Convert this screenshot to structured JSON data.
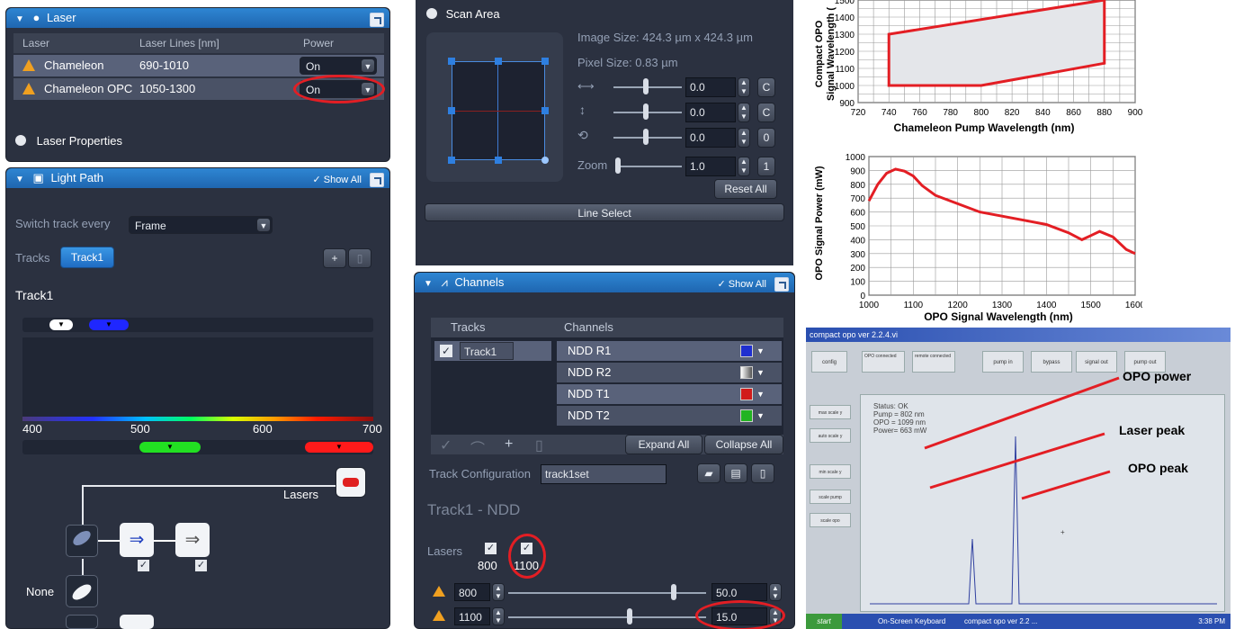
{
  "laser_panel": {
    "title": "Laser",
    "columns": [
      "Laser",
      "Laser Lines [nm]",
      "Power"
    ],
    "rows": [
      {
        "name": "Chameleon",
        "lines": "690-1010",
        "power": "On"
      },
      {
        "name": "Chameleon OPC",
        "lines": "1050-1300",
        "power": "On"
      }
    ],
    "properties_label": "Laser Properties"
  },
  "lightpath_panel": {
    "title": "Light Path",
    "show_all": "Show All",
    "switch_label": "Switch track every",
    "switch_value": "Frame",
    "tracks_label": "Tracks",
    "track_button": "Track1",
    "track_title": "Track1",
    "spectrum_ticks": [
      "400",
      "500",
      "600",
      "700"
    ],
    "lasers_label": "Lasers",
    "none_label": "None"
  },
  "scan_panel": {
    "title": "Scan Area",
    "image_size": "Image Size:  424.3 µm x 424.3 µm",
    "pixel_size": "Pixel Size:   0.83 µm",
    "offset_x": "0.0",
    "offset_y": "0.0",
    "rotation": "0.0",
    "zoom_label": "Zoom",
    "zoom_value": "1.0",
    "btn_c1": "C",
    "btn_c2": "C",
    "btn_0": "0",
    "btn_1": "1",
    "reset_all": "Reset All",
    "line_select": "Line Select"
  },
  "channels_panel": {
    "title": "Channels",
    "show_all": "Show All",
    "col_tracks": "Tracks",
    "col_channels": "Channels",
    "track_name": "Track1",
    "channels": [
      "NDD R1",
      "NDD R2",
      "NDD T1",
      "NDD T2"
    ],
    "channel_colors": [
      "#1f2fd0",
      "#d8d8d8",
      "#d11b1b",
      "#22b422"
    ],
    "expand_all": "Expand All",
    "collapse_all": "Collapse All",
    "track_config_label": "Track Configuration",
    "track_config_value": "track1set",
    "section_title": "Track1 - NDD",
    "lasers_label": "Lasers",
    "laser_800": "800",
    "laser_1100": "1100",
    "row1_wl": "800",
    "row1_value": "50.0",
    "row2_wl": "1100",
    "row2_value": "15.0"
  },
  "chart_top": {
    "ylabel_line1": "Compact OPO",
    "ylabel_line2": "Signal Wavelength (",
    "xlabel": "Chameleon Pump Wavelength (nm)",
    "x_ticks": [
      "720",
      "740",
      "760",
      "780",
      "800",
      "820",
      "840",
      "860",
      "880",
      "900"
    ],
    "y_ticks": [
      "900",
      "1000",
      "1100",
      "1200",
      "1300",
      "1400",
      "1500"
    ]
  },
  "chart_bottom": {
    "ylabel": "OPO Signal Power (mW)",
    "xlabel": "OPO Signal Wavelength (nm)",
    "x_ticks": [
      "1000",
      "1100",
      "1200",
      "1300",
      "1400",
      "1500",
      "1600"
    ],
    "y_ticks": [
      "0",
      "100",
      "200",
      "300",
      "400",
      "500",
      "600",
      "700",
      "800",
      "900",
      "1000"
    ]
  },
  "chart_data": [
    {
      "type": "area",
      "xlabel": "Chameleon Pump Wavelength (nm)",
      "ylabel": "Compact OPO Signal Wavelength (",
      "xlim": [
        720,
        900
      ],
      "ylim": [
        900,
        1500
      ],
      "polygon": [
        [
          740,
          1000
        ],
        [
          800,
          1000
        ],
        [
          880,
          1130
        ],
        [
          880,
          1500
        ],
        [
          740,
          1300
        ]
      ]
    },
    {
      "type": "line",
      "xlabel": "OPO Signal Wavelength (nm)",
      "ylabel": "OPO Signal Power (mW)",
      "xlim": [
        1000,
        1600
      ],
      "ylim": [
        0,
        1000
      ],
      "series": [
        {
          "x": [
            1000,
            1020,
            1040,
            1060,
            1080,
            1100,
            1120,
            1150,
            1200,
            1250,
            1300,
            1350,
            1400,
            1450,
            1480,
            1500,
            1520,
            1550,
            1580,
            1600
          ],
          "values": [
            680,
            800,
            880,
            910,
            895,
            860,
            790,
            720,
            660,
            600,
            570,
            540,
            510,
            450,
            400,
            430,
            460,
            420,
            330,
            300
          ]
        }
      ]
    }
  ],
  "photo": {
    "window_title": "compact opo ver 2.2.4.vi",
    "buttons_top": [
      "config",
      "OPO connected",
      "remote connected",
      "pump in",
      "bypass",
      "signal out",
      "pump out"
    ],
    "buttons_left": [
      "max scale y",
      "auto scale y",
      "min scale y",
      "scale pump",
      "scale opo"
    ],
    "status": [
      "Status: OK",
      "Pump = 802 nm",
      "OPO = 1099 nm",
      "Power= 663 mW"
    ],
    "annotation_power": "OPO power",
    "annotation_laser": "Laser peak",
    "annotation_opo": "OPO peak",
    "taskbar_start": "start",
    "taskbar_item1": "On-Screen Keyboard",
    "taskbar_item2": "compact opo ver 2.2 ...",
    "taskbar_time": "3:38 PM"
  }
}
